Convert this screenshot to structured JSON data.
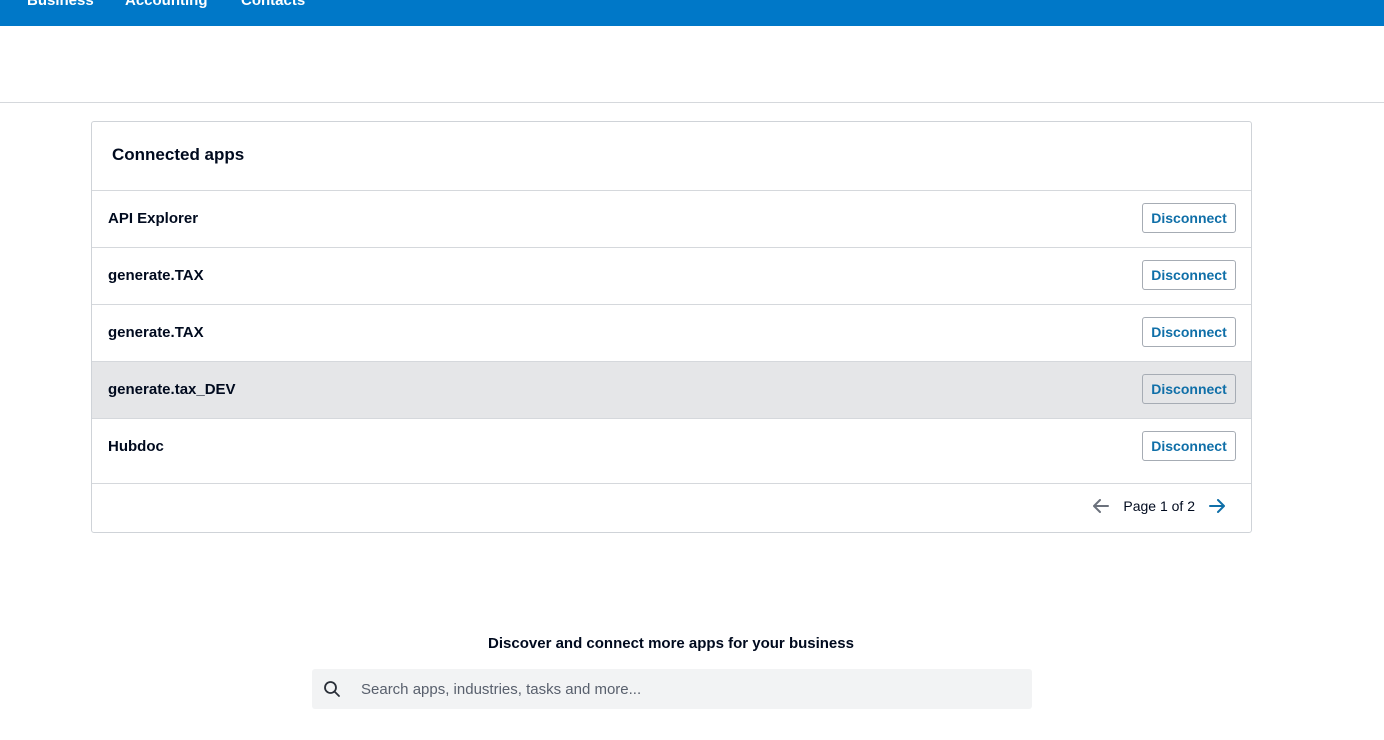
{
  "nav": {
    "items": [
      "Business",
      "Accounting",
      "Contacts"
    ]
  },
  "connected_apps": {
    "title": "Connected apps",
    "apps": [
      {
        "name": "API Explorer",
        "action": "Disconnect"
      },
      {
        "name": "generate.TAX",
        "action": "Disconnect"
      },
      {
        "name": "generate.TAX",
        "action": "Disconnect"
      },
      {
        "name": "generate.tax_DEV",
        "action": "Disconnect"
      },
      {
        "name": "Hubdoc",
        "action": "Disconnect"
      }
    ],
    "pagination": {
      "label": "Page 1 of 2",
      "current_page": 1,
      "total_pages": 2
    }
  },
  "discover": {
    "title": "Discover and connect more apps for your business",
    "search_placeholder": "Search apps, industries, tasks and more...",
    "search_value": ""
  },
  "colors": {
    "topbar": "#0078c8",
    "link": "#0f6fa8",
    "row_hover": "#e5e6e8",
    "search_bg": "#f2f3f4"
  },
  "icons": {
    "prev": "arrow-left-icon",
    "next": "arrow-right-icon",
    "search": "search-icon"
  }
}
